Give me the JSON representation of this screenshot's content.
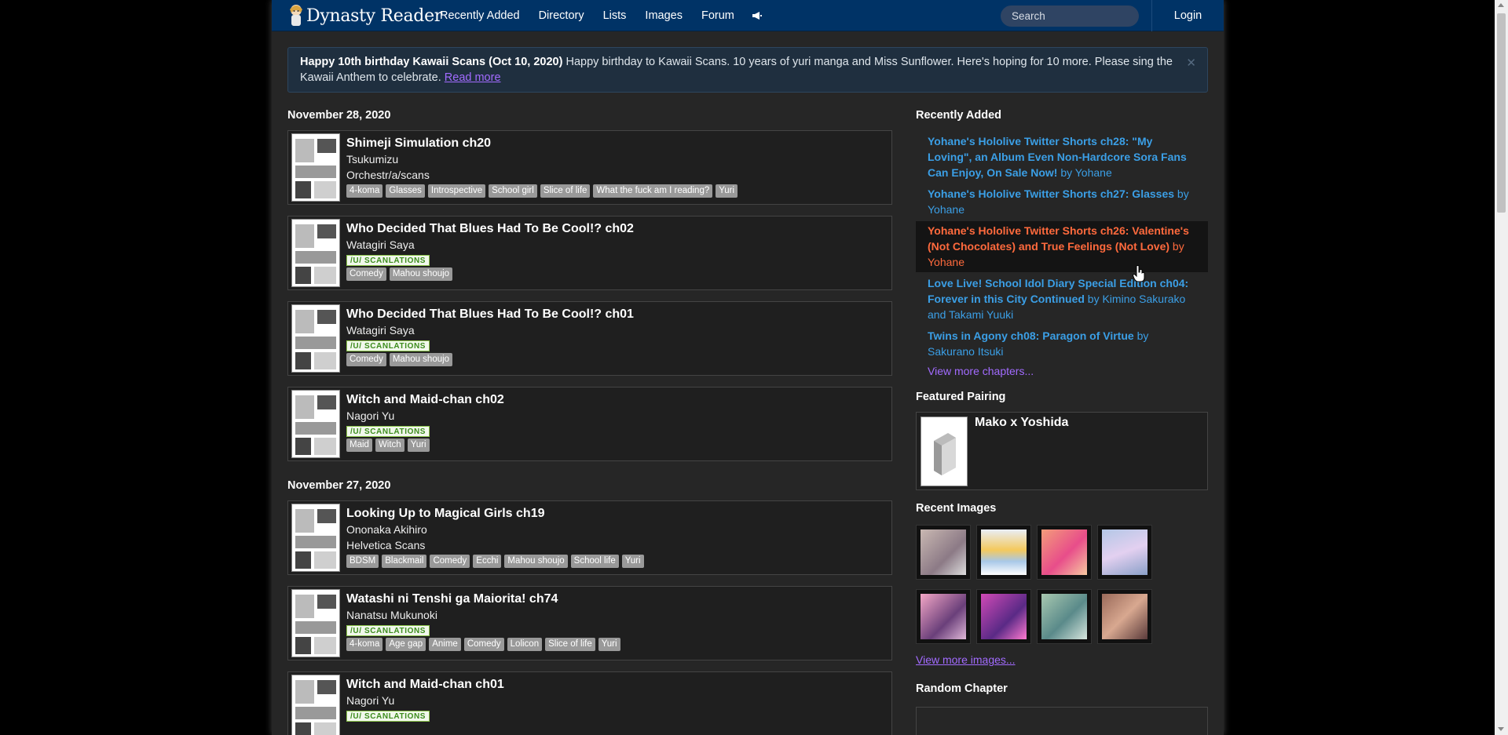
{
  "nav": {
    "brand": "Dynasty Reader",
    "links": [
      "Recently Added",
      "Directory",
      "Lists",
      "Images",
      "Forum"
    ],
    "search_placeholder": "Search",
    "login": "Login"
  },
  "announcement": {
    "title": "Happy 10th birthday Kawaii Scans (Oct 10, 2020)",
    "text": "Happy birthday to Kawaii Scans. 10 years of yuri manga and Miss Sunflower. Here's hoping for 10 more. Please sing the Kawaii Anthem to celebrate.",
    "link": "Read more",
    "close": "✕"
  },
  "groups": [
    {
      "date": "November 28, 2020",
      "chapters": [
        {
          "title": "Shimeji Simulation ch20",
          "author": "Tsukumizu",
          "scanlator": "Orchestr/a/scans",
          "tags": [
            "4-koma",
            "Glasses",
            "Introspective",
            "School girl",
            "Slice of life",
            "What the fuck am I reading?",
            "Yuri"
          ]
        },
        {
          "title": "Who Decided That Blues Had To Be Cool!? ch02",
          "author": "Watagiri Saya",
          "scanlator_badge": "/U/ SCANLATIONS",
          "tags": [
            "Comedy",
            "Mahou shoujo"
          ]
        },
        {
          "title": "Who Decided That Blues Had To Be Cool!? ch01",
          "author": "Watagiri Saya",
          "scanlator_badge": "/U/ SCANLATIONS",
          "tags": [
            "Comedy",
            "Mahou shoujo"
          ]
        },
        {
          "title": "Witch and Maid-chan ch02",
          "author": "Nagori Yu",
          "scanlator_badge": "/U/ SCANLATIONS",
          "tags": [
            "Maid",
            "Witch",
            "Yuri"
          ]
        }
      ]
    },
    {
      "date": "November 27, 2020",
      "chapters": [
        {
          "title": "Looking Up to Magical Girls ch19",
          "author": "Ononaka Akihiro",
          "scanlator": "Helvetica Scans",
          "tags": [
            "BDSM",
            "Blackmail",
            "Comedy",
            "Ecchi",
            "Mahou shoujo",
            "School life",
            "Yuri"
          ]
        },
        {
          "title": "Watashi ni Tenshi ga Maiorita! ch74",
          "author": "Nanatsu Mukunoki",
          "scanlator_badge": "/U/ SCANLATIONS",
          "tags": [
            "4-koma",
            "Age gap",
            "Anime",
            "Comedy",
            "Lolicon",
            "Slice of life",
            "Yuri"
          ]
        },
        {
          "title": "Witch and Maid-chan ch01",
          "author": "Nagori Yu",
          "scanlator_badge": "/U/ SCANLATIONS",
          "tags": []
        }
      ]
    }
  ],
  "sidebar": {
    "recent_heading": "Recently Added",
    "recent": [
      {
        "title": "Yohane's Hololive Twitter Shorts ch28: \"My Loving\", an Album Even Non-Hardcore Sora Fans Can Enjoy, On Sale Now!",
        "by": "by Yohane"
      },
      {
        "title": "Yohane's Hololive Twitter Shorts ch27: Glasses",
        "by": "by Yohane"
      },
      {
        "title": "Yohane's Hololive Twitter Shorts ch26: Valentine's (Not Chocolates) and True Feelings (Not Love)",
        "by": "by Yohane"
      },
      {
        "title": "Love Live! School Idol Diary Special Edition ch04: Forever in this City Continued",
        "by": "by Kimino Sakurako and Takami Yuuki"
      },
      {
        "title": "Twins in Agony ch08: Paragon of Virtue",
        "by": "by Sakurano Itsuki"
      }
    ],
    "view_more_chapters": "View more chapters...",
    "featured_heading": "Featured Pairing",
    "featured_name": "Mako x Yoshida",
    "images_heading": "Recent Images",
    "view_more_images": "View more images...",
    "random_heading": "Random Chapter"
  }
}
